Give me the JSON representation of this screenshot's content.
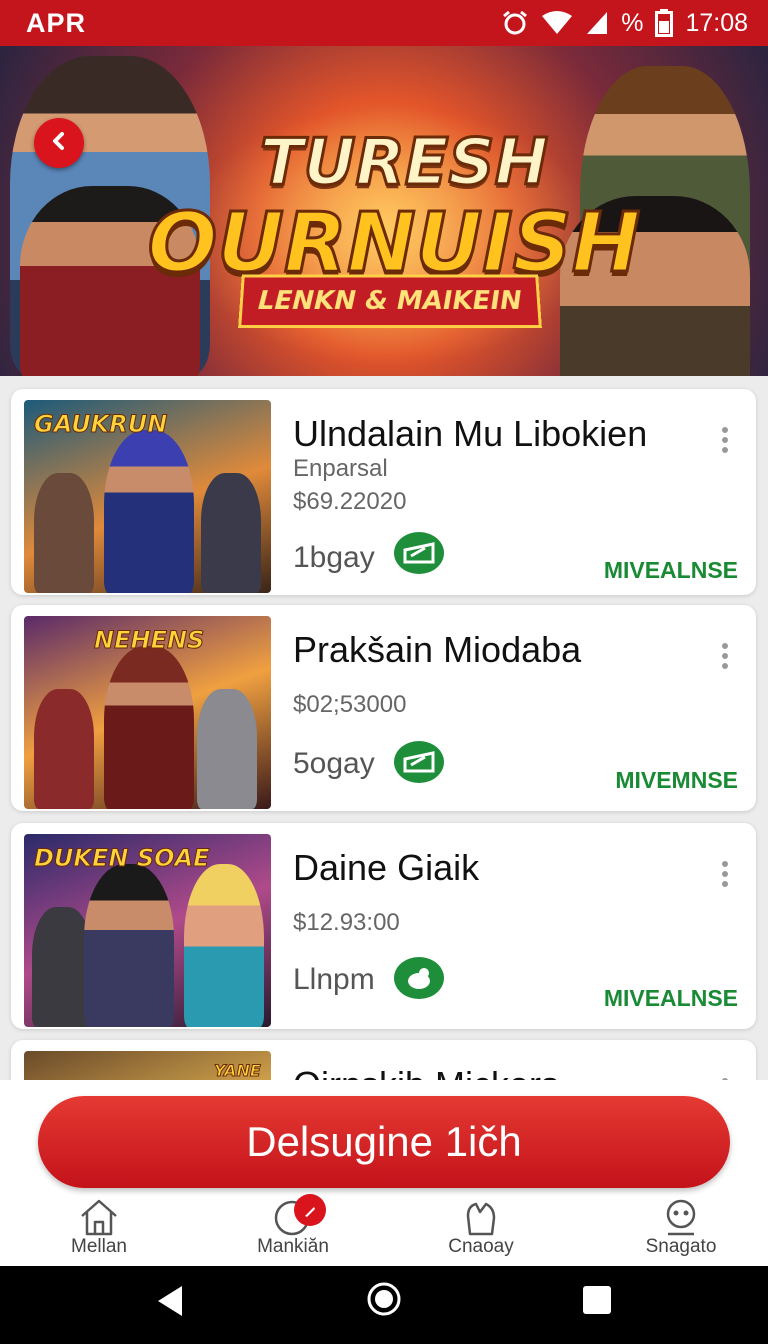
{
  "status_bar": {
    "carrier": "APR",
    "battery": "%",
    "time": "17:08"
  },
  "banner": {
    "title_line1": "TURESH",
    "title_line2": "OURNUISH",
    "ribbon": "LENKN & MAIKEIN"
  },
  "games": [
    {
      "thumb_title": "GAUKRUN",
      "title": "Ulndalain Mu Libokien",
      "subtitle": "Enparsal",
      "price": "$69.22020",
      "days": "1bgay",
      "status": "MIVEALNSE"
    },
    {
      "thumb_title": "NEHENS",
      "title": "Prakšain Miodaba",
      "subtitle": "",
      "price": "$02;53000",
      "days": "5ogay",
      "status": "MIVEMNSE"
    },
    {
      "thumb_title": "DUKEN SOAE",
      "title": "Daine Giaik",
      "subtitle": "",
      "price": "$12.93:00",
      "days": "Llnpm",
      "status": "MIVEALNSE"
    },
    {
      "thumb_title": "YANE",
      "title": "Oirnskib Mickers",
      "subtitle": "",
      "price": "",
      "days": "",
      "status": ""
    }
  ],
  "cta": {
    "label": "Delsugine 1ičh"
  },
  "nav": [
    {
      "label": "Mellan",
      "icon": "home-icon"
    },
    {
      "label": "Mankiăn",
      "icon": "compass-icon"
    },
    {
      "label": "Cnaoay",
      "icon": "hand-icon"
    },
    {
      "label": "Snagato",
      "icon": "profile-icon"
    }
  ],
  "colors": {
    "brand_red": "#c4141c",
    "status_green": "#1a8a35"
  }
}
